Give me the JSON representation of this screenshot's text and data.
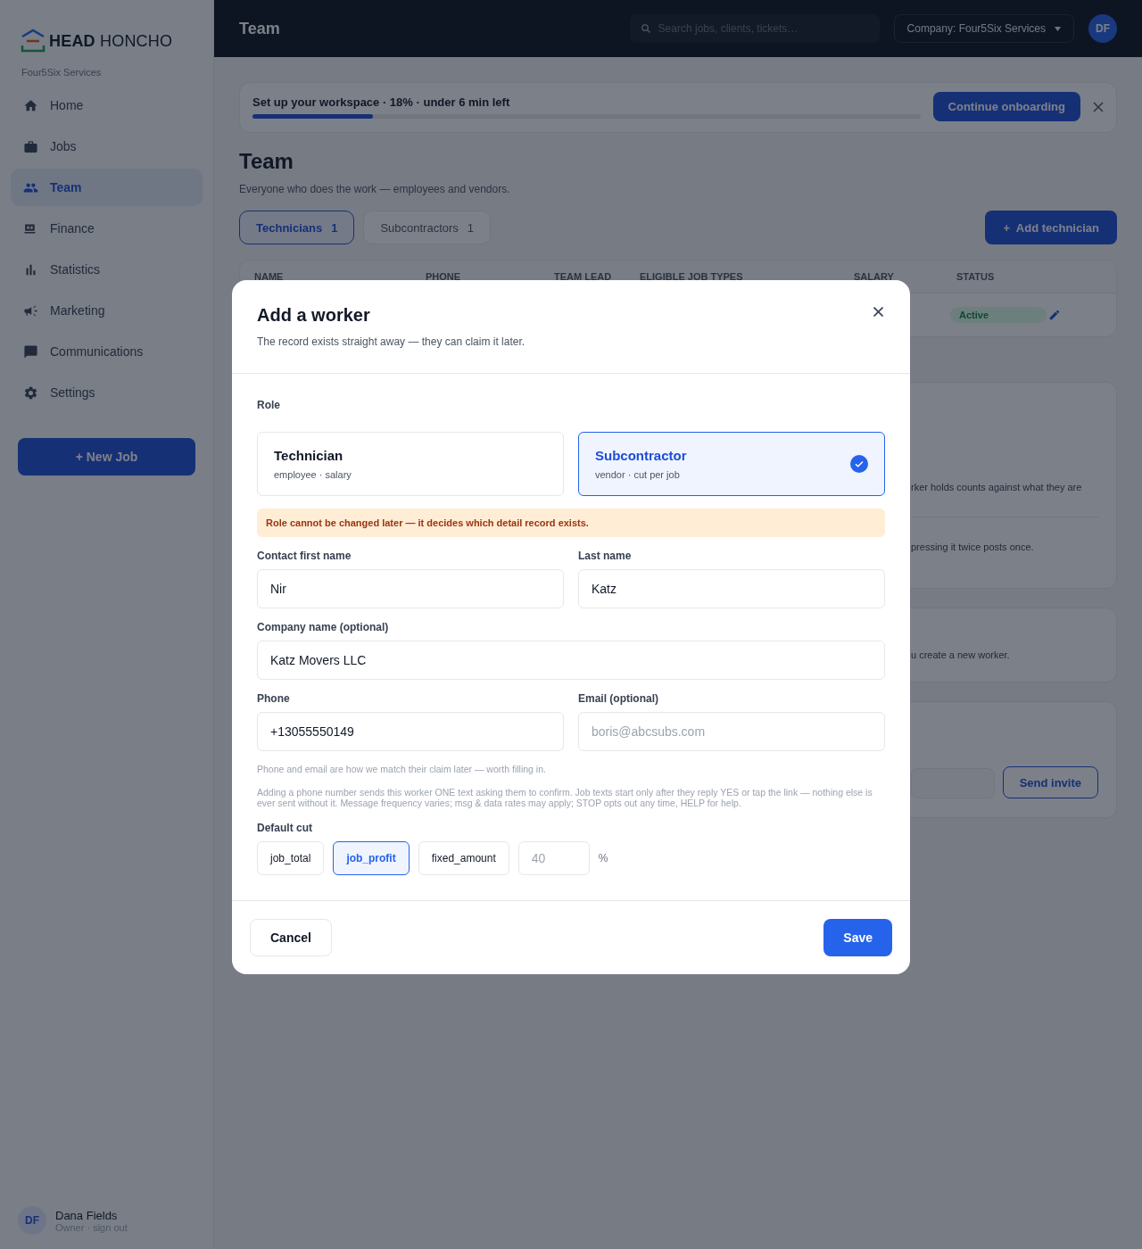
{
  "sidebar": {
    "logo": {
      "bold": "HEAD",
      "light": "HONCHO"
    },
    "company": "Four5Six Services",
    "items": [
      {
        "label": "Home",
        "selected": false
      },
      {
        "label": "Jobs",
        "selected": false
      },
      {
        "label": "Team",
        "selected": true
      },
      {
        "label": "Finance",
        "selected": false
      },
      {
        "label": "Statistics",
        "selected": false
      },
      {
        "label": "Marketing",
        "selected": false
      },
      {
        "label": "Communications",
        "selected": false
      },
      {
        "label": "Settings",
        "selected": false
      }
    ],
    "new_job_button": "+ New Job",
    "user": {
      "initials": "DF",
      "name": "Dana Fields",
      "subtitle": "Owner · sign out"
    }
  },
  "topbar": {
    "title": "Team",
    "search": {
      "placeholder": "Search jobs, clients, tickets…"
    },
    "company_select": "Company: Four5Six Services",
    "avatar": "DF"
  },
  "onboarding": {
    "text": "Set up your workspace · 18% · under 6 min left",
    "level": 0.18,
    "button": "Continue onboarding"
  },
  "page": {
    "title": "Team",
    "subtitle": "Everyone who does the work — employees and vendors.",
    "tabs": [
      {
        "label": "Technicians",
        "count": "1",
        "selected": true
      },
      {
        "label": "Subcontractors",
        "count": "1",
        "selected": false
      }
    ],
    "add_button": "+  Add technician"
  },
  "table": {
    "columns": [
      "NAME",
      "PHONE",
      "TEAM LEAD",
      "ELIGIBLE JOB TYPES",
      "SALARY",
      "STATUS"
    ],
    "rows": [
      {
        "status": "Active"
      }
    ]
  },
  "background_cards": [
    {
      "lines": [
        "rker holds counts against what they are",
        "pressing it twice posts once."
      ]
    },
    {
      "lines": [
        "u create a new worker."
      ]
    },
    {
      "button": "Send invite"
    }
  ],
  "modal": {
    "title": "Add a worker",
    "subtitle": "The record exists straight away — they can claim it later.",
    "role_label": "Role",
    "roles": [
      {
        "title": "Technician",
        "subtitle": "employee · salary",
        "selected": false
      },
      {
        "title": "Subcontractor",
        "subtitle": "vendor · cut per job",
        "selected": true
      }
    ],
    "warning": "Role cannot be changed later — it decides which detail record exists.",
    "field_rows": [
      [
        {
          "label": "Contact first name",
          "value": "Nir"
        },
        {
          "label": "Last name",
          "value": "Katz"
        }
      ],
      [
        {
          "label": "Company name (optional)",
          "value": "Katz Movers LLC"
        }
      ],
      [
        {
          "label": "Phone",
          "value": "+13055550149"
        },
        {
          "label": "Email (optional)",
          "placeholder": "boris@abcsubs.com"
        }
      ]
    ],
    "hints": [
      "Phone and email are how we match their claim later — worth filling in.",
      "Adding a phone number sends this worker ONE text asking them to confirm. Job texts start only after they reply YES or tap the link — nothing else is ever sent without it. Message frequency varies; msg & data rates may apply; STOP opts out any time, HELP for help."
    ],
    "default_cut": {
      "label": "Default cut",
      "options": [
        {
          "label": "job_total",
          "selected": false
        },
        {
          "label": "job_profit",
          "selected": true
        },
        {
          "label": "fixed_amount",
          "selected": false
        }
      ],
      "amount": {
        "placeholder": "40"
      },
      "unit": "%"
    },
    "cancel_button": "Cancel",
    "save_button": "Save"
  }
}
